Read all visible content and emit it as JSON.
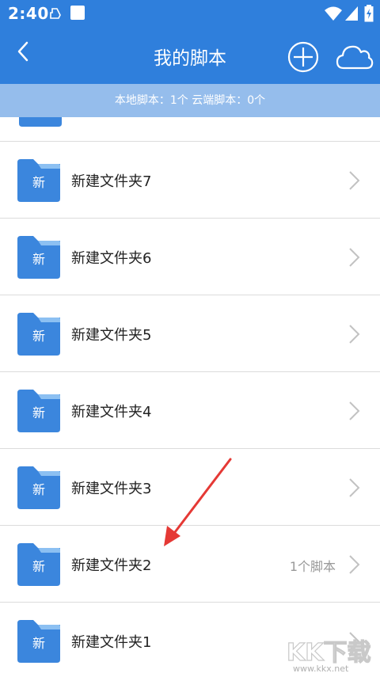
{
  "status_bar": {
    "time": "2:40"
  },
  "app_bar": {
    "title": "我的脚本",
    "back_icon": "chevron-left-icon",
    "add_icon": "plus-circle-icon",
    "cloud_icon": "cloud-icon"
  },
  "summary": {
    "text": "本地脚本：1个 云端脚本：0个"
  },
  "folders": [
    {
      "badge": "新",
      "name": "新建文件夹7",
      "count": ""
    },
    {
      "badge": "新",
      "name": "新建文件夹6",
      "count": ""
    },
    {
      "badge": "新",
      "name": "新建文件夹5",
      "count": ""
    },
    {
      "badge": "新",
      "name": "新建文件夹4",
      "count": ""
    },
    {
      "badge": "新",
      "name": "新建文件夹3",
      "count": ""
    },
    {
      "badge": "新",
      "name": "新建文件夹2",
      "count": "1个脚本"
    },
    {
      "badge": "新",
      "name": "新建文件夹1",
      "count": ""
    }
  ],
  "colors": {
    "primary": "#2f7fdc",
    "summary_bg": "#95bdec",
    "folder_body": "#3b86dd",
    "folder_tab": "#8cc0f2",
    "annotation": "#e53935"
  },
  "watermark": {
    "logo_text": "KK下载",
    "url": "www.kkx.net"
  }
}
